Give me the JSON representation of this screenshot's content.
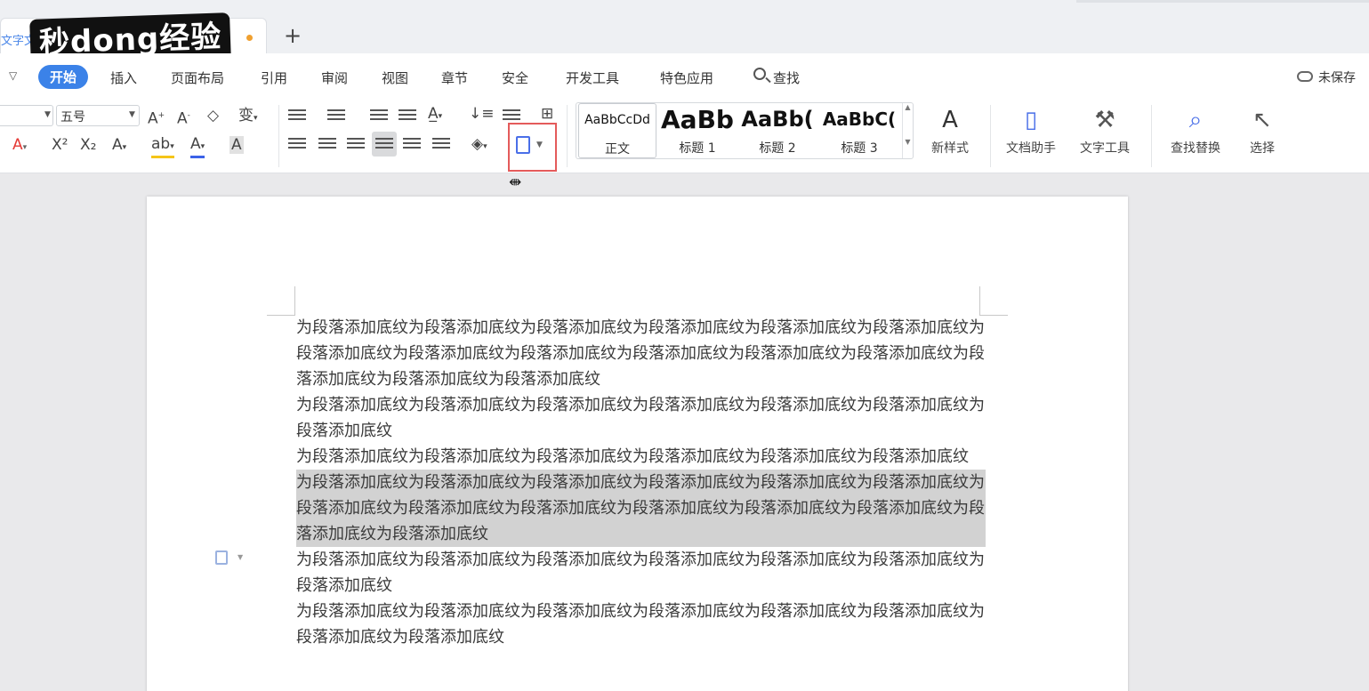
{
  "tabs": {
    "doc_title": "文字文",
    "new_tab_label": "+"
  },
  "watermark": {
    "text": "秒dong经验"
  },
  "menu": {
    "items": [
      "开始",
      "插入",
      "页面布局",
      "引用",
      "审阅",
      "视图",
      "章节",
      "安全",
      "开发工具",
      "特色应用",
      "查找"
    ],
    "active": "开始",
    "unsaved_label": "未保存"
  },
  "ribbon": {
    "font_size": "五号",
    "styles": [
      {
        "preview": "AaBbCcDd",
        "name": "正文"
      },
      {
        "preview": "AaBb",
        "name": "标题 1"
      },
      {
        "preview": "AaBb(",
        "name": "标题 2"
      },
      {
        "preview": "AaBbC(",
        "name": "标题 3"
      }
    ],
    "new_style": "新样式",
    "doc_assistant": "文档助手",
    "text_tools": "文字工具",
    "find_replace": "查找替换",
    "select": "选择"
  },
  "document": {
    "paragraphs": [
      {
        "text": "为段落添加底纹为段落添加底纹为段落添加底纹为段落添加底纹为段落添加底纹为段落添加底纹为段落添加底纹为段落添加底纹为段落添加底纹为段落添加底纹为段落添加底纹为段落添加底纹为段落添加底纹为段落添加底纹为段落添加底纹",
        "shaded": false
      },
      {
        "text": "为段落添加底纹为段落添加底纹为段落添加底纹为段落添加底纹为段落添加底纹为段落添加底纹为段落添加底纹",
        "shaded": false
      },
      {
        "text": "为段落添加底纹为段落添加底纹为段落添加底纹为段落添加底纹为段落添加底纹为段落添加底纹",
        "shaded": false
      },
      {
        "text": "为段落添加底纹为段落添加底纹为段落添加底纹为段落添加底纹为段落添加底纹为段落添加底纹为段落添加底纹为段落添加底纹为段落添加底纹为段落添加底纹为段落添加底纹为段落添加底纹为段落添加底纹为段落添加底纹",
        "shaded": true
      },
      {
        "text": "为段落添加底纹为段落添加底纹为段落添加底纹为段落添加底纹为段落添加底纹为段落添加底纹为段落添加底纹",
        "shaded": false
      },
      {
        "text": "为段落添加底纹为段落添加底纹为段落添加底纹为段落添加底纹为段落添加底纹为段落添加底纹为段落添加底纹为段落添加底纹",
        "shaded": false
      }
    ]
  },
  "colors": {
    "accent": "#3b82e8",
    "highlight_box": "#e45b5b",
    "shading": "#d2d2d2"
  }
}
